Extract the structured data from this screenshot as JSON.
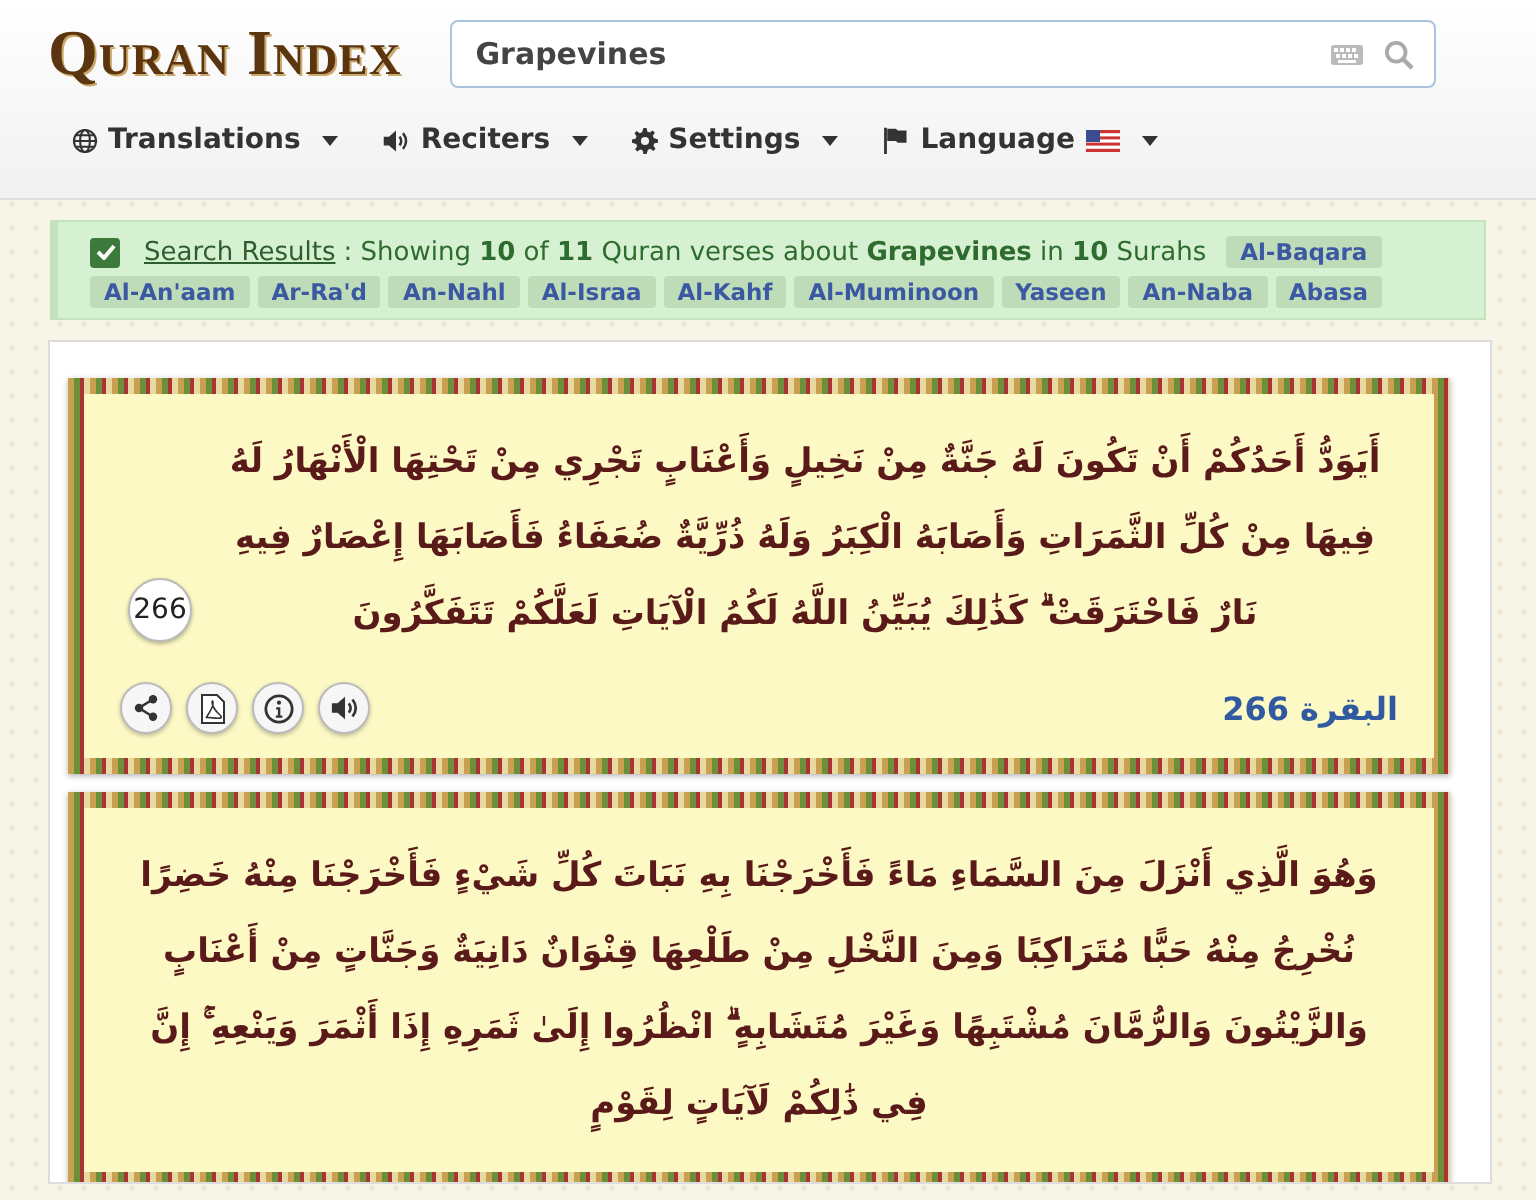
{
  "header": {
    "logo": "Quran Index",
    "search": {
      "value": "Grapevines"
    },
    "menu": [
      {
        "kind": "globe",
        "label": "Translations"
      },
      {
        "kind": "speaker",
        "label": "Reciters"
      },
      {
        "kind": "gear",
        "label": "Settings"
      },
      {
        "kind": "flag",
        "label": "Language"
      }
    ]
  },
  "results": {
    "checked": true,
    "link": "Search Results",
    "summary": ": Showing **10** of **11** Quran verses about **Grapevines** in **10** Surahs",
    "surahs": [
      "Al-Baqara",
      "Al-An'aam",
      "Ar-Ra'd",
      "An-Nahl",
      "Al-Israa",
      "Al-Kahf",
      "Al-Muminoon",
      "Yaseen",
      "An-Naba",
      "Abasa"
    ]
  },
  "verses": [
    {
      "text": "أَيَوَدُّ أَحَدُكُمْ أَنْ تَكُونَ لَهُ جَنَّةٌ مِنْ نَخِيلٍ وَأَعْنَابٍ تَجْرِي مِنْ تَحْتِهَا الْأَنْهَارُ لَهُ فِيهَا مِنْ كُلِّ الثَّمَرَاتِ وَأَصَابَهُ الْكِبَرُ وَلَهُ ذُرِّيَّةٌ ضُعَفَاءُ فَأَصَابَهَا إِعْصَارٌ فِيهِ نَارٌ فَاحْتَرَقَتْ ۗ كَذَٰلِكَ يُبَيِّنُ اللَّهُ لَكُمُ الْآيَاتِ لَعَلَّكُمْ تَتَفَكَّرُونَ",
      "number": "266",
      "reference": "البقرة 266",
      "actions": [
        {
          "kind": "share"
        },
        {
          "kind": "pdf"
        },
        {
          "kind": "info"
        },
        {
          "kind": "audio"
        }
      ]
    },
    {
      "text": "وَهُوَ الَّذِي أَنْزَلَ مِنَ السَّمَاءِ مَاءً فَأَخْرَجْنَا بِهِ نَبَاتَ كُلِّ شَيْءٍ فَأَخْرَجْنَا مِنْهُ خَضِرًا نُخْرِجُ مِنْهُ حَبًّا مُتَرَاكِبًا وَمِنَ النَّخْلِ مِنْ طَلْعِهَا قِنْوَانٌ دَانِيَةٌ وَجَنَّاتٍ مِنْ أَعْنَابٍ وَالزَّيْتُونَ وَالرُّمَّانَ مُشْتَبِهًا وَغَيْرَ مُتَشَابِهٍ ۗ انْظُرُوا إِلَىٰ ثَمَرِهِ إِذَا أَثْمَرَ وَيَنْعِهِ ۚ إِنَّ فِي ذَٰلِكُمْ لَآيَاتٍ لِقَوْمٍ"
    }
  ]
}
